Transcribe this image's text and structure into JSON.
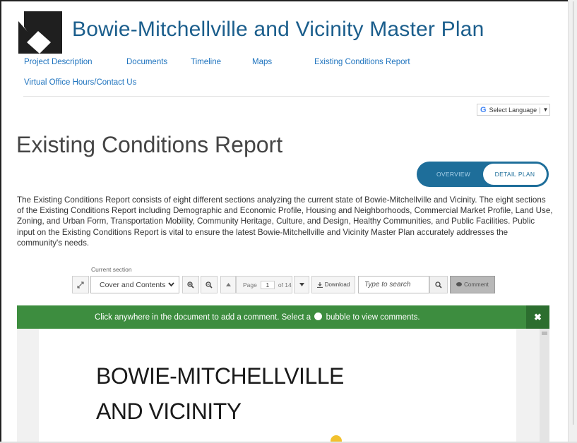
{
  "site": {
    "title": "Bowie-Mitchellville and Vicinity Master Plan"
  },
  "nav": {
    "items": [
      "Project Description",
      "Documents",
      "Timeline",
      "Maps",
      "Existing Conditions Report",
      "Virtual Office Hours/Contact Us"
    ]
  },
  "translate": {
    "icon": "google-g-icon",
    "label": "Select Language",
    "caret": "▼"
  },
  "page": {
    "heading": "Existing Conditions Report",
    "intro": "The Existing Conditions Report consists of eight different sections analyzing the current state of Bowie-Mitchellville and Vicinity. The eight sections of the Existing Conditions Report including Demographic and Economic Profile, Housing and Neighborhoods, Commercial Market Profile, Land Use, Zoning, and Urban Form, Transportation Mobility, Community Heritage, Culture, and Design, Healthy Communities, and Public Facilities. Public input on the Existing Conditions Report is vital to ensure the latest Bowie-Mitchellville and Vicinity Master Plan accurately addresses the community's needs."
  },
  "toggle": {
    "overview": "OVERVIEW",
    "detail": "DETAIL PLAN",
    "active": "detail"
  },
  "viewer_toolbar": {
    "section_label": "Current section",
    "section_value": "Cover and Contents",
    "page_label": "Page",
    "page_value": "1",
    "page_total": "of 14",
    "download_label": "Download",
    "search_placeholder": "Type to search",
    "comment_label": "Comment"
  },
  "banner": {
    "text_before": "Click anywhere in the document to add a comment. Select a",
    "text_after": "bubble to view comments.",
    "close": "✖",
    "color": "#3d8d3f"
  },
  "document": {
    "line1": "BOWIE-MITCHELLVILLE",
    "line2": "AND VICINITY"
  },
  "colors": {
    "title_blue": "#1b5e8c",
    "link_blue": "#1e73be",
    "toggle_blue": "#1e6e9a",
    "banner_green": "#3d8d3f"
  }
}
